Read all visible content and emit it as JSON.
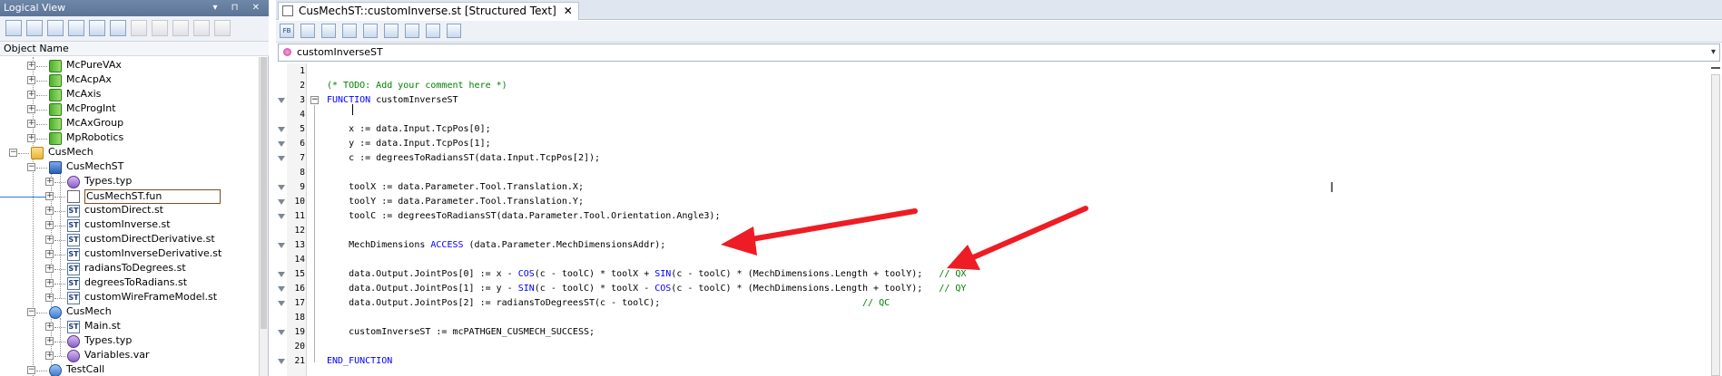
{
  "logical_view": {
    "title": "Logical View",
    "title_controls": "▾ ⊓ ✕",
    "column_header": "Object Name",
    "toolbar_icons": [
      "project-icon",
      "table-icon",
      "window-icon",
      "help-book-icon",
      "gear-people-icon",
      "settings-icon",
      "cog-icon",
      "tag-icon",
      "wrench-icon",
      "tools-icon",
      "hammer-icon"
    ],
    "tree": [
      {
        "label": "McPureVAx",
        "icon": "library-green-icon"
      },
      {
        "label": "McAcpAx",
        "icon": "library-green-icon"
      },
      {
        "label": "McAxis",
        "icon": "library-green-icon"
      },
      {
        "label": "McProgInt",
        "icon": "library-green-icon"
      },
      {
        "label": "McAxGroup",
        "icon": "library-green-icon"
      },
      {
        "label": "MpRobotics",
        "icon": "library-green-icon"
      },
      {
        "label": "CusMech",
        "icon": "folder-icon"
      },
      {
        "label": "CusMechST",
        "icon": "library-blue-icon"
      },
      {
        "label": "Types.typ",
        "icon": "types-icon"
      },
      {
        "label": "CusMechST.fun",
        "icon": "function-file-icon"
      },
      {
        "label": "customDirect.st",
        "icon": "st-file-icon"
      },
      {
        "label": "customInverse.st",
        "icon": "st-file-icon"
      },
      {
        "label": "customDirectDerivative.st",
        "icon": "st-file-icon"
      },
      {
        "label": "customInverseDerivative.st",
        "icon": "st-file-icon"
      },
      {
        "label": "radiansToDegrees.st",
        "icon": "st-file-icon"
      },
      {
        "label": "degreesToRadians.st",
        "icon": "st-file-icon"
      },
      {
        "label": "customWireFrameModel.st",
        "icon": "st-file-icon"
      },
      {
        "label": "CusMech",
        "icon": "program-icon"
      },
      {
        "label": "Main.st",
        "icon": "st-file-icon"
      },
      {
        "label": "Types.typ",
        "icon": "types-icon"
      },
      {
        "label": "Variables.var",
        "icon": "variables-icon"
      },
      {
        "label": "TestCall",
        "icon": "program-icon"
      }
    ],
    "st_badge": "ST"
  },
  "editor": {
    "tab_title": "CusMechST::customInverse.st [Structured Text]",
    "tab_close": "✕",
    "toolbar_icons": [
      "fb-icon",
      "pencil-icon",
      "abc-icon",
      "st-icon",
      "indent-icon",
      "outdent-icon",
      "list-indent-icon",
      "list-outdent-icon",
      "comment-icon"
    ],
    "fb_label": "FB",
    "selector_value": "customInverseST",
    "code_lines": [
      {
        "n": "1",
        "html": ""
      },
      {
        "n": "2",
        "html": "<span class=\"cm\">(* TODO: Add your comment here *)</span>"
      },
      {
        "n": "3",
        "html": "<span class=\"kw\">FUNCTION</span> customInverseST"
      },
      {
        "n": "4",
        "html": ""
      },
      {
        "n": "5",
        "html": "    x := data.Input.TcpPos[0];"
      },
      {
        "n": "6",
        "html": "    y := data.Input.TcpPos[1];"
      },
      {
        "n": "7",
        "html": "    c := degreesToRadiansST(data.Input.TcpPos[2]);"
      },
      {
        "n": "8",
        "html": ""
      },
      {
        "n": "9",
        "html": "    toolX := data.Parameter.Tool.Translation.X;"
      },
      {
        "n": "10",
        "html": "    toolY := data.Parameter.Tool.Translation.Y;"
      },
      {
        "n": "11",
        "html": "    toolC := degreesToRadiansST(data.Parameter.Tool.Orientation.Angle3);"
      },
      {
        "n": "12",
        "html": ""
      },
      {
        "n": "13",
        "html": "    MechDimensions <span class=\"kw\">ACCESS</span> (data.Parameter.MechDimensionsAddr);"
      },
      {
        "n": "14",
        "html": ""
      },
      {
        "n": "15",
        "html": "    data.Output.JointPos[0] := x - <span class=\"kw\">COS</span>(c - toolC) * toolX + <span class=\"kw\">SIN</span>(c - toolC) * (MechDimensions.Length + toolY);   <span class=\"cm\">// QX</span>"
      },
      {
        "n": "16",
        "html": "    data.Output.JointPos[1] := y - <span class=\"kw\">SIN</span>(c - toolC) * toolX - <span class=\"kw\">COS</span>(c - toolC) * (MechDimensions.Length + toolY);   <span class=\"cm\">// QY</span>"
      },
      {
        "n": "17",
        "html": "    data.Output.JointPos[2] := radiansToDegreesST(c - toolC);                                     <span class=\"cm\">// QC</span>"
      },
      {
        "n": "18",
        "html": ""
      },
      {
        "n": "19",
        "html": "    customInverseST := mcPATHGEN_CUSMECH_SUCCESS;"
      },
      {
        "n": "20",
        "html": ""
      },
      {
        "n": "21",
        "html": "<span class=\"kw\">END_FUNCTION</span>"
      }
    ],
    "fold_marks": [
      "3",
      "5",
      "6",
      "7",
      "9",
      "10",
      "11",
      "13",
      "15",
      "16",
      "17",
      "19",
      "21"
    ],
    "fold_minus": "−"
  },
  "annotation_arrows": {
    "color": "#ee1c24",
    "count": 2
  }
}
